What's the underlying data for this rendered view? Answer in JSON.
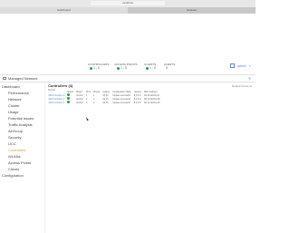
{
  "browser": {
    "url": "localhost",
    "tabs": [
      {
        "label": "Dashboard"
      },
      {
        "label": "Network"
      }
    ]
  },
  "header": {
    "stats": [
      {
        "label": "CONTROLLERS",
        "online": "3",
        "offline": "0"
      },
      {
        "label": "ACCESS POINTS",
        "online": "3",
        "offline": "0"
      },
      {
        "label": "CLIENTS",
        "online": "4",
        "offline": "0"
      },
      {
        "label": "ALERTS",
        "online": "",
        "offline": "0"
      }
    ],
    "user_menu": "admin"
  },
  "network_bar": {
    "name": "Managed Network"
  },
  "sidebar": {
    "items": [
      {
        "label": "Dashboard",
        "level": "top"
      },
      {
        "label": "Performance",
        "level": "sub"
      },
      {
        "label": "Network",
        "level": "sub"
      },
      {
        "label": "Cluster",
        "level": "sub"
      },
      {
        "label": "Usage",
        "level": "sub"
      },
      {
        "label": "Potential Issues",
        "level": "sub"
      },
      {
        "label": "Traffic Analysis",
        "level": "sub"
      },
      {
        "label": "AirGroup",
        "level": "sub"
      },
      {
        "label": "Security",
        "level": "sub"
      },
      {
        "label": "UCC",
        "level": "sub"
      },
      {
        "label": "Controllers",
        "level": "sub",
        "active": true
      },
      {
        "label": "WLANs",
        "level": "sub"
      },
      {
        "label": "Access Points",
        "level": "sub"
      },
      {
        "label": "Clients",
        "level": "sub"
      },
      {
        "label": "Configuration",
        "level": "top"
      }
    ]
  },
  "main": {
    "title": "Controllers (3)",
    "filter": "Default Columns",
    "subtitle": "Name",
    "columns": [
      "",
      "Status",
      "Model",
      "IPv4",
      "Clients",
      "Uptime",
      "Configuration State",
      "Version",
      "MAC Address"
    ],
    "rows": [
      [
        "MM-Controller-1",
        "up",
        "Aruba7",
        "1",
        "1",
        "6d 4h",
        "Update successful",
        "8.3.0.0",
        "00:1A:1E:DA:A7"
      ],
      [
        "MM-Controller-2",
        "up",
        "Aruba7",
        "2",
        "1",
        "6d 4h",
        "Update successful",
        "8.3.0.0",
        "00:1A:1E:DA:A8"
      ],
      [
        "MM-Controller-3",
        "up",
        "Aruba7",
        "3",
        "2",
        "6d 4h",
        "Update successful",
        "8.3.0.0",
        "00:1A:1E:DA:A9"
      ]
    ]
  },
  "colors": {
    "accent": "#5a8cc8",
    "status_up": "#2a9d4a",
    "active_nav": "#c8a24a"
  }
}
